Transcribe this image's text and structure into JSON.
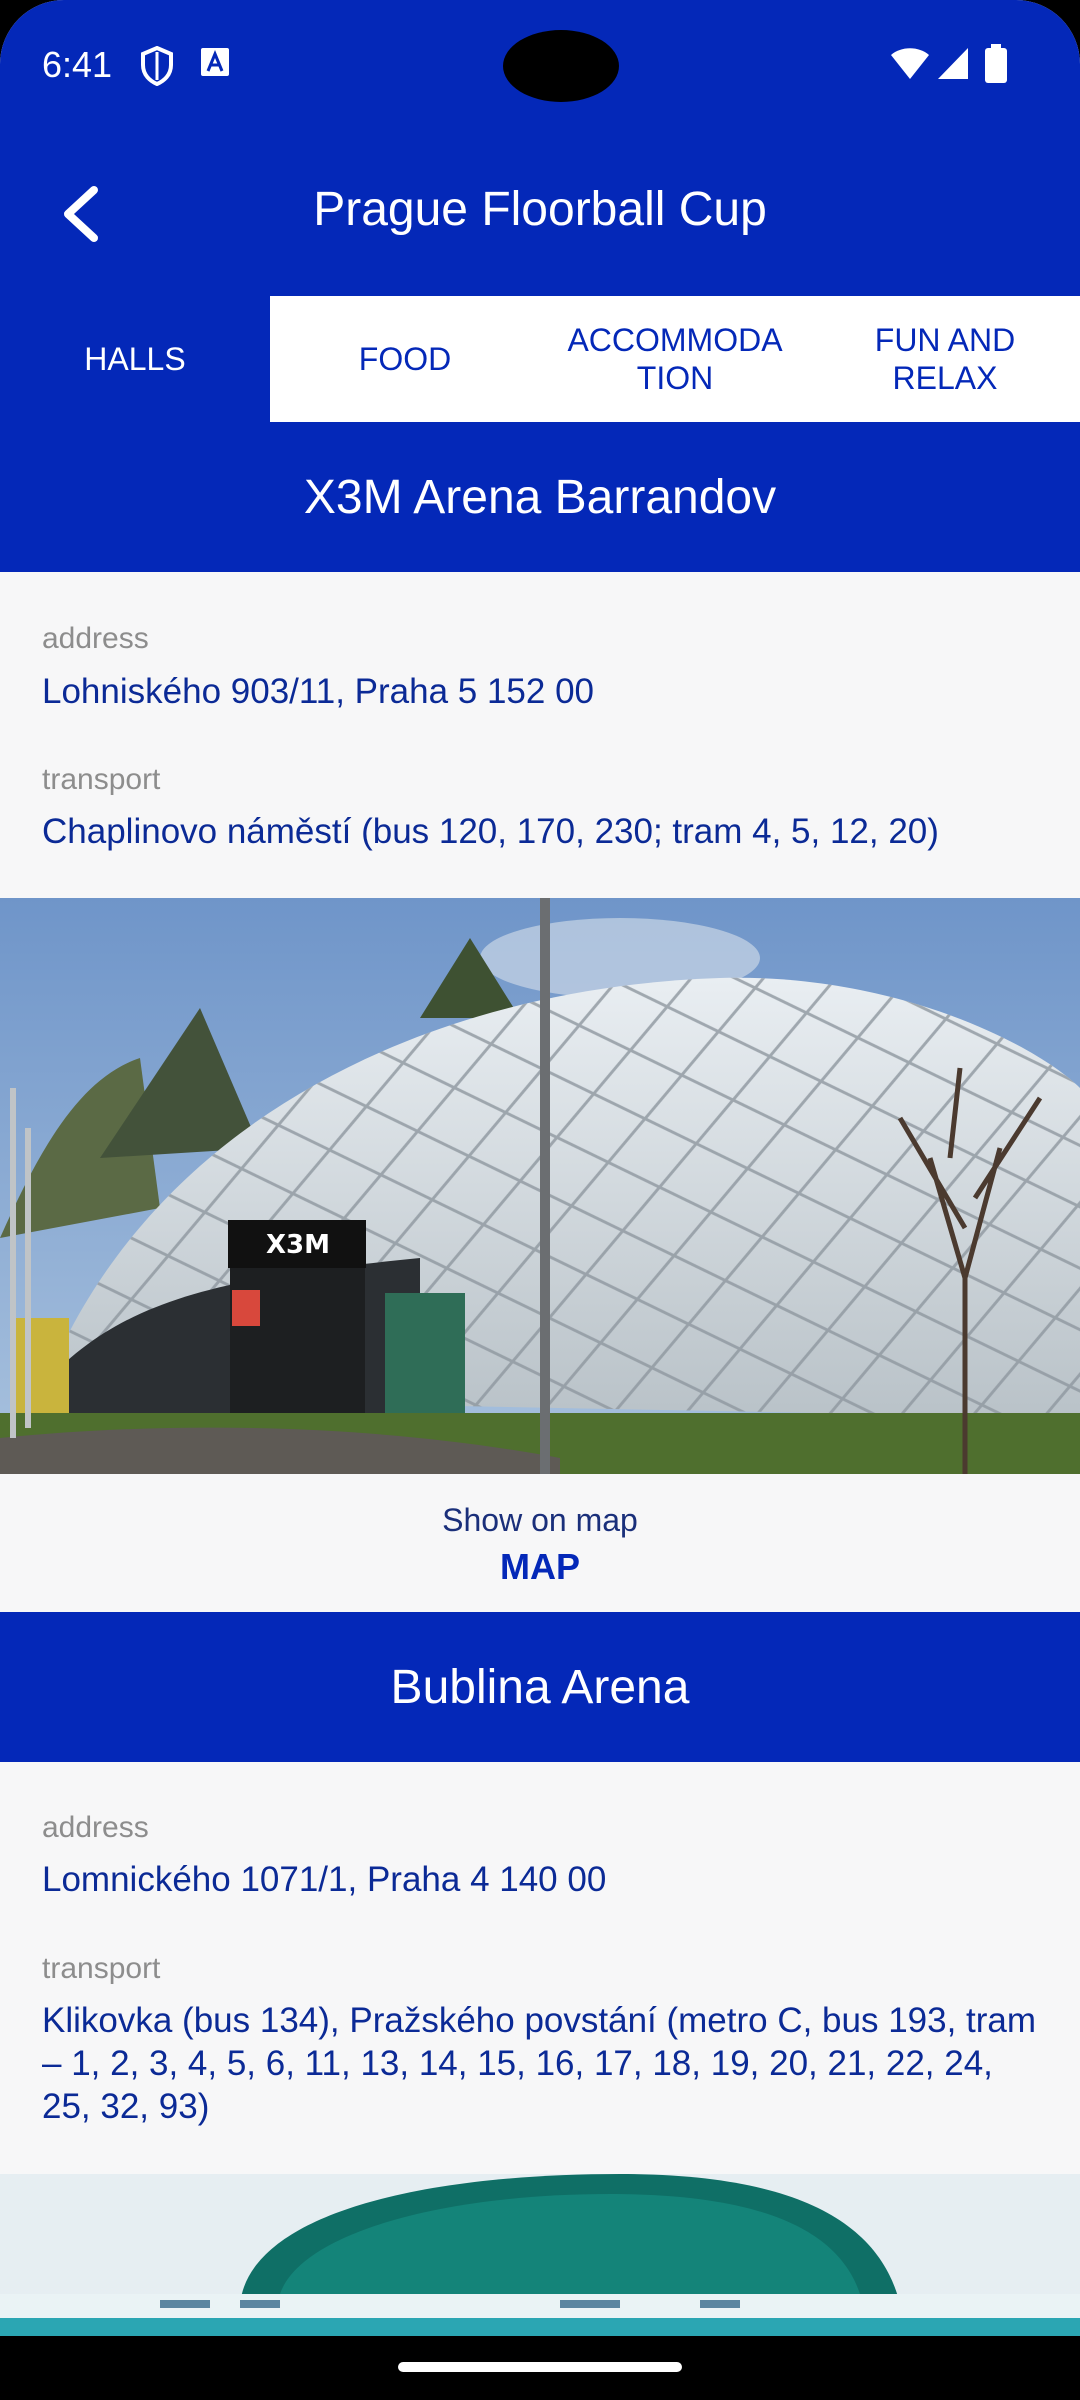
{
  "status_bar": {
    "time": "6:41"
  },
  "app_bar": {
    "title": "Prague Floorball Cup",
    "back_icon": "chevron-left-icon"
  },
  "tabs": [
    {
      "label": "HALLS",
      "active": true
    },
    {
      "label": "FOOD",
      "active": false
    },
    {
      "label": "ACCOMMODA\nTION",
      "active": false
    },
    {
      "label": "FUN AND\nRELAX",
      "active": false
    }
  ],
  "halls": [
    {
      "name": "X3M Arena Barrandov",
      "address_label": "address",
      "address": "Lohniského 903/11, Praha 5 152 00",
      "transport_label": "transport",
      "transport": "Chaplinovo náměstí (bus 120, 170, 230; tram 4, 5, 12, 20)",
      "photo_sign": "X3M",
      "map_caption": "Show on map",
      "map_button": "MAP"
    },
    {
      "name": "Bublina Arena",
      "address_label": "address",
      "address": "Lomnického 1071/1, Praha 4 140 00",
      "transport_label": "transport",
      "transport": "Klikovka (bus 134), Pražského povstání (metro C, bus 193, tram – 1, 2, 3, 4, 5, 6, 11, 13, 14, 15, 16, 17, 18, 19, 20, 21, 22, 24, 25, 32, 93)"
    }
  ],
  "colors": {
    "primary": "#0428b8",
    "value_text": "#0b2a96",
    "label_text": "#8d8d8d",
    "background": "#f7f7f8"
  }
}
